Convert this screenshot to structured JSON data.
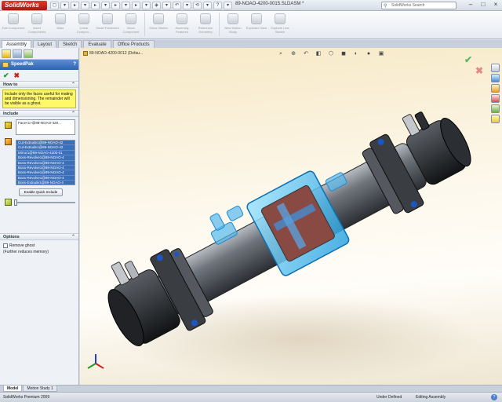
{
  "app": {
    "logo_text": "SolidWorks",
    "doc_title": "89-NOAO-4200-0015.SLDASM *",
    "search_placeholder": "SolidWorks Search",
    "quick_access": [
      "◻",
      "▾",
      "▸",
      "▾",
      "▸",
      "▾",
      "▸",
      "▾",
      "▸",
      "▾",
      "◈",
      "▾",
      "↶",
      "▾",
      "⟲",
      "▾",
      "?",
      "▾"
    ]
  },
  "ribbon": {
    "buttons": [
      {
        "label": "Edit Component"
      },
      {
        "label": "Insert Components"
      },
      {
        "label": "Mate"
      },
      {
        "label": "Linear Compon..."
      },
      {
        "label": "Smart Fasteners"
      },
      {
        "label": "Move Component"
      },
      {
        "label": "Show Hidden"
      },
      {
        "label": "Assembly Features"
      },
      {
        "label": "Reference Geometry"
      },
      {
        "label": "New Motion Study"
      },
      {
        "label": "Exploded View"
      },
      {
        "label": "Explode Line Sketch"
      }
    ]
  },
  "command_tabs": [
    "Assembly",
    "Layout",
    "Sketch",
    "Evaluate",
    "Office Products"
  ],
  "property_manager": {
    "title": "SpeedPak",
    "how_to_heading": "How to",
    "how_to_text": "Include only the faces useful for mating and dimensioning. The remainder will be visible as a ghost.",
    "include_heading": "Include",
    "face_entry": "Face<1>@89-NOAO-420...",
    "features": [
      "Cut-Extrude1@89-NOAO-42",
      "Cut-Extrude1@89-NOAO-42",
      "Mirror1@89-NOAO-4200-01",
      "Boss-Revolve1@89-NOAO-4",
      "Boss-Revolve1@89-NOAO-4",
      "Boss-Revolve1@89-NOAO-4",
      "Boss-Revolve1@89-NOAO-4",
      "Boss-Revolve1@89-NOAO-4",
      "Boss-Extrude1@89-NOAO-4"
    ],
    "quick_include_label": "Enable Quick Include",
    "options_heading": "Options",
    "remove_ghost_label": "Remove ghost",
    "reduce_memory_text": "(Further reduces memory)"
  },
  "viewport": {
    "tree_crumb": "89-NOAO-4200-0012 (Defau..."
  },
  "bottom_tabs": [
    "Model",
    "Motion Study 1"
  ],
  "status": {
    "product": "SolidWorks Premium 2009",
    "defined": "Under Defined",
    "mode": "Editing Assembly",
    "help": "?"
  }
}
